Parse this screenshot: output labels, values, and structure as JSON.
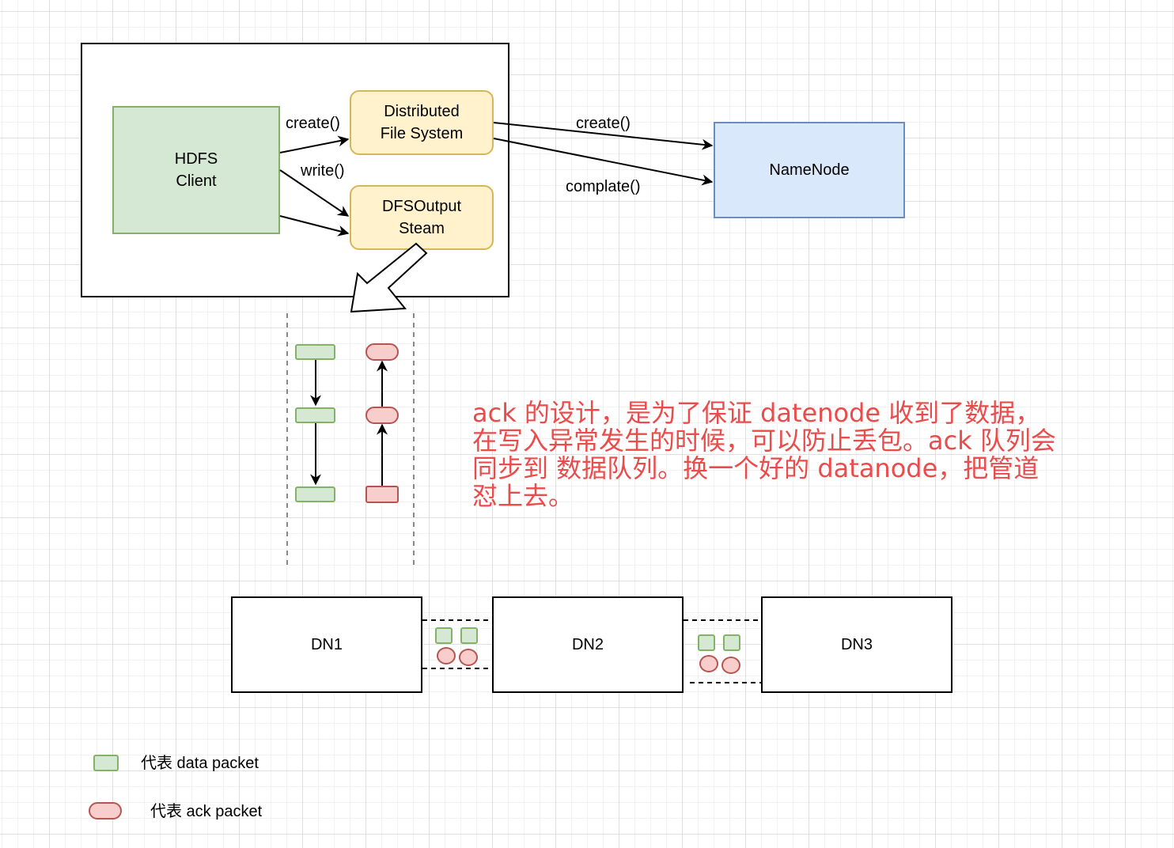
{
  "colors": {
    "client_fill": "#d5e8d4",
    "client_stroke": "#82b366",
    "yellow_fill": "#fff2cc",
    "yellow_stroke": "#d6b656",
    "namenode_fill": "#dae8fc",
    "namenode_stroke": "#6c8ebf",
    "ack_fill": "#f8cecc",
    "ack_stroke": "#b85450",
    "note_text": "#ea4b4b"
  },
  "client_box": {
    "client": "HDFS\nClient",
    "client_line1": "HDFS",
    "client_line2": "Client",
    "dfs_line1": "Distributed",
    "dfs_line2": "File System",
    "stream_line1": "DFSOutput",
    "stream_line2": "Steam"
  },
  "edges": {
    "create_local": "create()",
    "write_local": "write()",
    "create_remote": "create()",
    "complete_remote": "complate()"
  },
  "namenode": {
    "label": "NameNode"
  },
  "note": {
    "lines": [
      "ack 的设计，是为了保证 datenode 收到了数据，",
      "在写入异常发生的时候，可以防止丢包。ack 队列会",
      "同步到 数据队列。换一个好的 datanode，把管道",
      "怼上去。"
    ]
  },
  "datanodes": [
    {
      "label": "DN1"
    },
    {
      "label": "DN2"
    },
    {
      "label": "DN3"
    }
  ],
  "legend": {
    "data_packet": "代表 data packet",
    "ack_packet": "代表 ack packet"
  }
}
